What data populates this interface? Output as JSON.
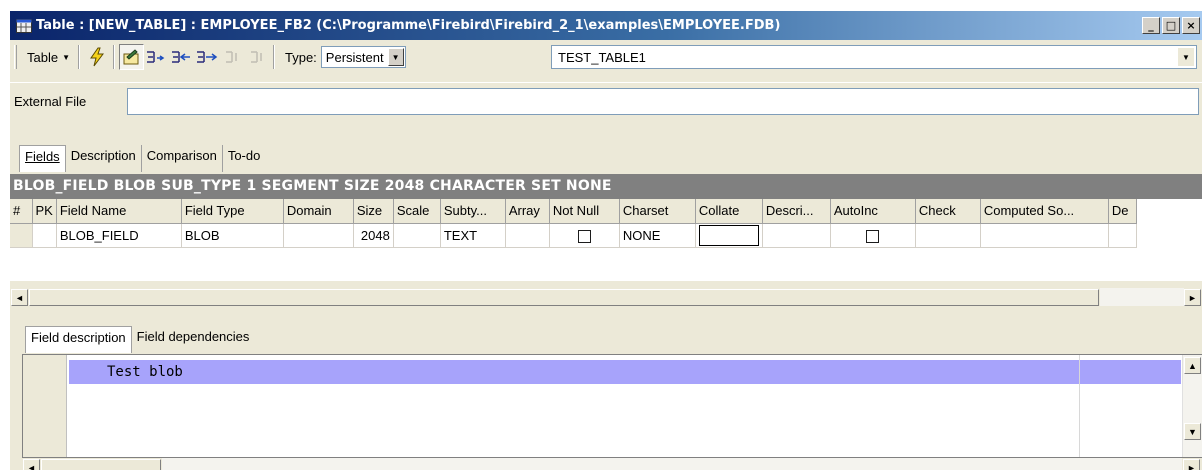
{
  "window": {
    "title": "Table : [NEW_TABLE] : EMPLOYEE_FB2 (C:\\Programme\\Firebird\\Firebird_2_1\\examples\\EMPLOYEE.FDB)",
    "min_glyph": "_",
    "max_glyph": "□",
    "close_glyph": "×"
  },
  "toolbar": {
    "table_menu_label": "Table",
    "dropdown_glyph": "▼",
    "type_label": "Type:",
    "type_value": "Persistent",
    "table_name": "TEST_TABLE1"
  },
  "external_file": {
    "label": "External File",
    "value": ""
  },
  "tabs": [
    {
      "label": "Fields",
      "active": true
    },
    {
      "label": "Description",
      "active": false
    },
    {
      "label": "Comparison",
      "active": false
    },
    {
      "label": "To-do",
      "active": false
    }
  ],
  "field_header_text": "BLOB_FIELD BLOB SUB_TYPE 1 SEGMENT SIZE 2048 CHARACTER SET NONE",
  "grid": {
    "columns": [
      "#",
      "PK",
      "Field Name",
      "Field Type",
      "Domain",
      "Size",
      "Scale",
      "Subty...",
      "Array",
      "Not Null",
      "Charset",
      "Collate",
      "Descri...",
      "AutoInc",
      "Check",
      "Computed So...",
      "De"
    ],
    "rows": [
      {
        "num": "",
        "pk": "",
        "field_name": "BLOB_FIELD",
        "field_type": "BLOB",
        "domain": "",
        "size": "2048",
        "scale": "",
        "subtype": "TEXT",
        "array": "",
        "not_null": false,
        "charset": "NONE",
        "collate": "",
        "description": "",
        "autoinc": false,
        "check": "",
        "computed_source": ""
      }
    ]
  },
  "scroll": {
    "left_glyph": "◄",
    "right_glyph": "►",
    "up_glyph": "▲",
    "down_glyph": "▼"
  },
  "bottom_tabs": [
    {
      "label": "Field description",
      "active": true
    },
    {
      "label": "Field dependencies",
      "active": false
    }
  ],
  "field_description_text": "Test blob",
  "colors": {
    "title_gradient_start": "#0a246a",
    "title_gradient_end": "#a6caf0",
    "header_bar": "#808080",
    "editor_highlight": "#a7a3fb",
    "window_face": "#ece9d8"
  },
  "icons": [
    "table-icon",
    "compile-icon",
    "edit-field-icon",
    "add-field-icon",
    "insert-field-icon",
    "delete-field-icon",
    "move-up-icon",
    "move-down-icon"
  ]
}
